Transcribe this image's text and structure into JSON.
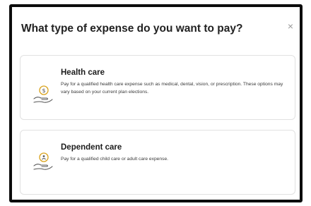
{
  "dialog": {
    "title": "What type of expense do you want to pay?",
    "close_glyph": "×"
  },
  "options": [
    {
      "title": "Health care",
      "description": "Pay for a qualified health care expense such as medical, dental, vision, or prescription. These options may vary based on your current plan elections.",
      "icon": "dollar-hand-icon"
    },
    {
      "title": "Dependent care",
      "description": "Pay for a qualified child care or adult care expense.",
      "icon": "care-hand-icon"
    }
  ],
  "colors": {
    "icon_accent": "#d9a21b",
    "icon_stroke": "#555555"
  }
}
